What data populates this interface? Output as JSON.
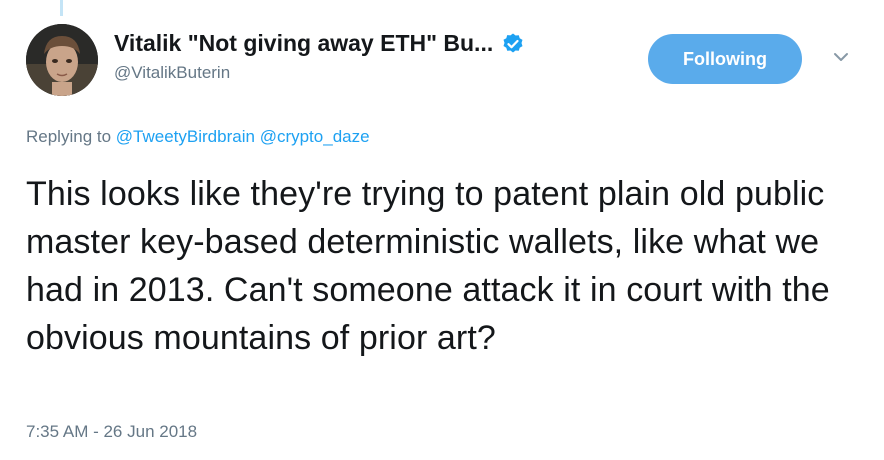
{
  "author": {
    "display_name": "Vitalik \"Not giving away ETH\" Bu...",
    "handle": "@VitalikButerin",
    "verified_icon": "verified-badge-icon",
    "avatar": "profile-photo"
  },
  "follow_button": {
    "label": "Following",
    "color": "#5aabeb"
  },
  "menu_icon": "chevron-down-icon",
  "reply": {
    "prefix": "Replying to",
    "mentions": [
      "@TweetyBirdbrain",
      "@crypto_daze"
    ]
  },
  "tweet": {
    "text": "This looks like they're trying to patent plain old public master key-based deterministic wallets, like what we had in 2013. Can't someone attack it in court with the obvious mountains of prior art?",
    "timestamp": "7:35 AM - 26 Jun 2018"
  },
  "colors": {
    "link": "#1da1f2",
    "muted": "#657786",
    "text": "#14171a"
  }
}
